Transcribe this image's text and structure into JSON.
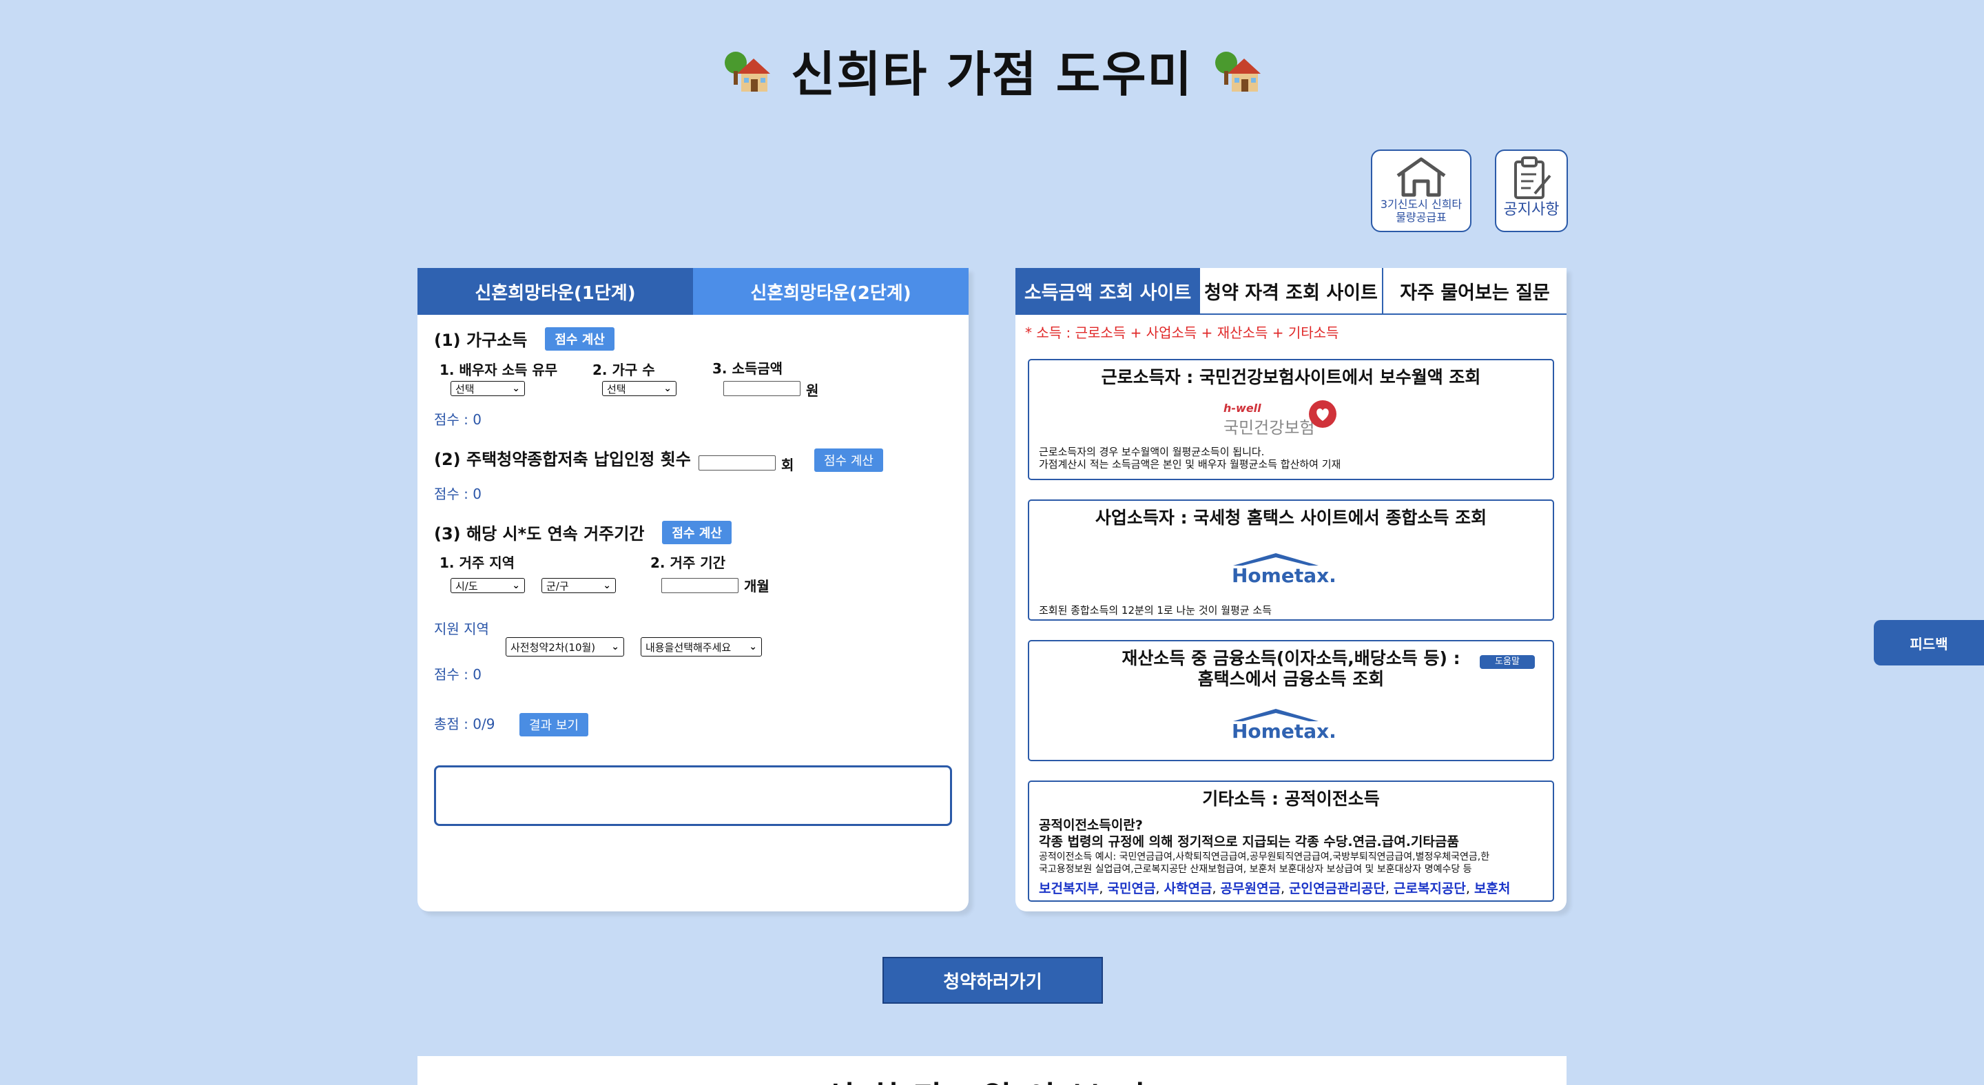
{
  "header": {
    "title": "신희타 가점 도우미",
    "icon_left": "house-tree-emoji",
    "icon_right": "house-tree-emoji"
  },
  "top_buttons": {
    "home_label": "3기신도시 신희타 물량공급표",
    "notice_label": "공지사항"
  },
  "left_tabs": [
    "신혼희망타운(1단계)",
    "신혼희망타운(2단계)"
  ],
  "section1": {
    "title": "(1) 가구소득",
    "calc_btn": "점수 계산",
    "q1": "1. 배우자 소득 유무",
    "q2": "2. 가구 수",
    "q3": "3. 소득금액",
    "sel1": "선택",
    "sel2": "선택",
    "unit": "원",
    "score": "점수 : 0"
  },
  "section2": {
    "title": "(2) 주택청약종합저축 납입인정 횟수",
    "unit": "회",
    "calc_btn": "점수 계산",
    "score": "점수 : 0"
  },
  "section3": {
    "title": "(3) 해당 시*도 연속 거주기간",
    "calc_btn": "점수 계산",
    "q1": "1. 거주 지역",
    "q2": "2. 거주 기간",
    "sel_sido": "시/도",
    "sel_gugun": "군/구",
    "unit": "개월",
    "support_label": "지원 지역",
    "sel_round": "사전청약2차(10월)",
    "sel_content": "내용을선택해주세요",
    "score": "점수 : 0"
  },
  "total": {
    "label": "총점 : 0/9",
    "result_btn": "결과 보기"
  },
  "right_tabs": [
    "소득금액 조회 사이트",
    "청약 자격 조회 사이트",
    "자주 물어보는 질문"
  ],
  "income_note": "* 소득 : 근로소득 + 사업소득 + 재산소득 + 기타소득",
  "cards": {
    "c1": {
      "title": "근로소득자 : 국민건강보험사이트에서 보수월액 조회",
      "logo_top": "h-well",
      "logo_main": "국민건강보험",
      "line1": "근로소득자의 경우 보수월액이 월평균소득이 됩니다.",
      "line2": "가점계산시 적는 소득금액은 본인 및 배우자 월평균소득 합산하여 기재"
    },
    "c2": {
      "title": "사업소득자 : 국세청 홈택스 사이트에서 종합소득 조회",
      "logo": "Hometax.",
      "line1": "조회된 종합소득의 12분의 1로 나눈 것이 월평균 소득"
    },
    "c3": {
      "title1": "재산소득 중 금융소득(이자소득,배당소득 등) :",
      "title2": "홈택스에서 금융소득 조회",
      "help_btn": "도움말",
      "logo": "Hometax."
    },
    "c4": {
      "title": "기타소득 : 공적이전소득",
      "q": "공적이전소득이란?",
      "def": "각종 법령의 규정에 의해 정기적으로 지급되는 각종 수당.연금.급여.기타금품",
      "ex1": "공적이전소득 예시: 국민연금급여,사학퇴직연금급여,공무원퇴직연금급여,국방부퇴직연금급여,별정우체국연금,한",
      "ex2": "국고용정보원 실업급여,근로복지공단 산재보험급여, 보훈처 보훈대상자 보상급여 및 보훈대상자 명예수당 등",
      "links": [
        "보건복지부",
        "국민연금",
        "사학연금",
        "공무원연금",
        "군인연금관리공단",
        "근로복지공단",
        "보훈처"
      ]
    }
  },
  "go_btn": "청약하러가기",
  "feedback_btn": "피드백",
  "bottom_title": "신희타 알아보기"
}
